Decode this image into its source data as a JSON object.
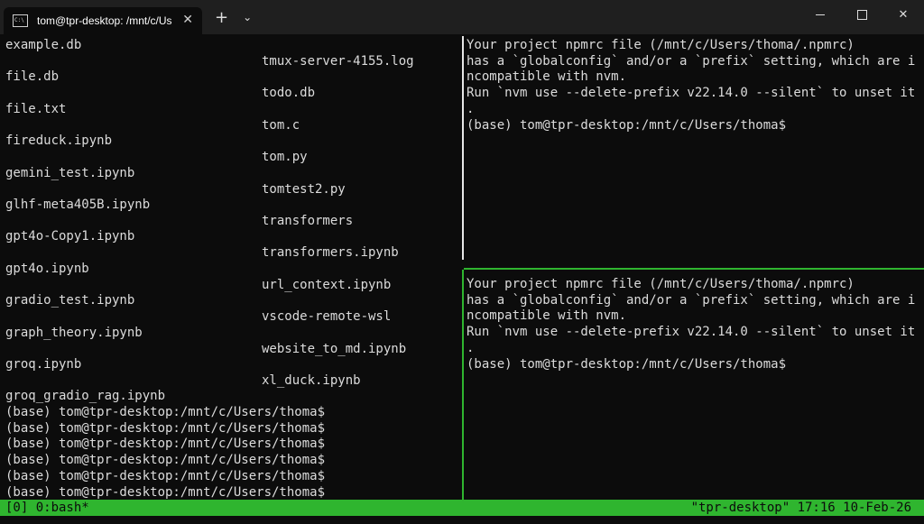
{
  "window": {
    "tab_title": "tom@tpr-desktop: /mnt/c/Us",
    "tab_close": "✕",
    "new_tab": "+",
    "dropdown": "⌄",
    "close": "✕"
  },
  "left_pane": {
    "col1": [
      "example.db",
      "file.db",
      "file.txt",
      "fireduck.ipynb",
      "gemini_test.ipynb",
      "glhf-meta405B.ipynb",
      "gpt4o-Copy1.ipynb",
      "gpt4o.ipynb",
      "gradio_test.ipynb",
      "graph_theory.ipynb",
      "groq.ipynb",
      "groq_gradio_rag.ipynb"
    ],
    "col2": [
      "tmux-server-4155.log",
      "todo.db",
      "tom.c",
      "tom.py",
      "tomtest2.py",
      "transformers",
      "transformers.ipynb",
      "url_context.ipynb",
      "vscode-remote-wsl",
      "website_to_md.ipynb",
      "xl_duck.ipynb"
    ],
    "prompts": [
      "(base) tom@tpr-desktop:/mnt/c/Users/thoma$",
      "(base) tom@tpr-desktop:/mnt/c/Users/thoma$",
      "(base) tom@tpr-desktop:/mnt/c/Users/thoma$",
      "(base) tom@tpr-desktop:/mnt/c/Users/thoma$",
      "(base) tom@tpr-desktop:/mnt/c/Users/thoma$",
      "(base) tom@tpr-desktop:/mnt/c/Users/thoma$"
    ]
  },
  "top_right_pane": {
    "lines": [
      "Your project npmrc file (/mnt/c/Users/thoma/.npmrc)",
      "has a `globalconfig` and/or a `prefix` setting, which are i",
      "ncompatible with nvm.",
      "Run `nvm use --delete-prefix v22.14.0 --silent` to unset it",
      ".",
      "(base) tom@tpr-desktop:/mnt/c/Users/thoma$"
    ]
  },
  "bottom_right_pane": {
    "lines": [
      "Your project npmrc file (/mnt/c/Users/thoma/.npmrc)",
      "has a `globalconfig` and/or a `prefix` setting, which are i",
      "ncompatible with nvm.",
      "Run `nvm use --delete-prefix v22.14.0 --silent` to unset it",
      ".",
      "(base) tom@tpr-desktop:/mnt/c/Users/thoma$"
    ]
  },
  "status": {
    "left": "[0] 0:bash*",
    "right": "\"tpr-desktop\" 17:16 10-Feb-26"
  },
  "colors": {
    "background": "#0c0c0c",
    "tmux_green": "#2fb52f",
    "text": "#dcdcdc"
  }
}
